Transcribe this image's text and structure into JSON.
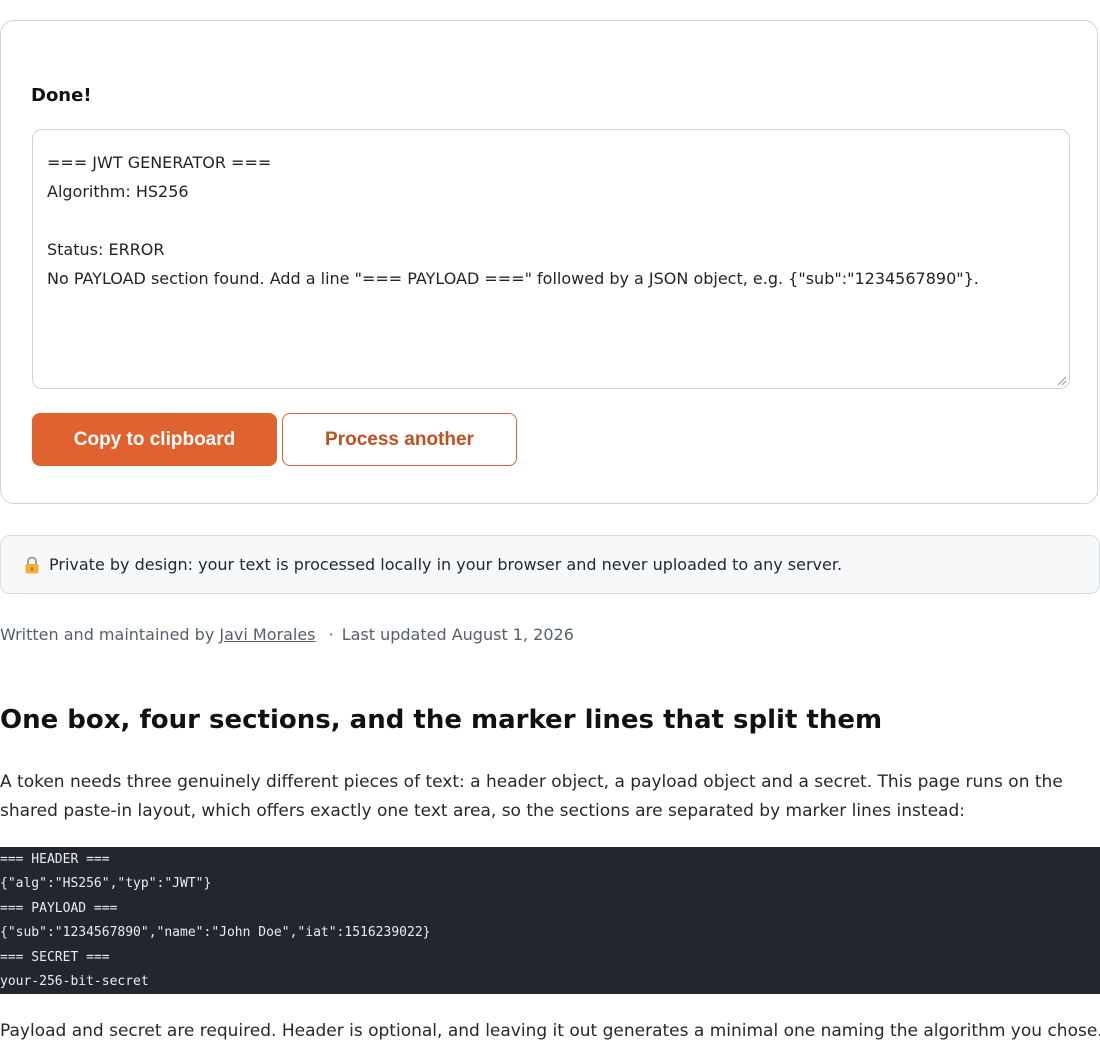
{
  "result": {
    "status_heading": "Done!",
    "output_lines": [
      "=== JWT GENERATOR ===",
      "Algorithm: HS256",
      "",
      "Status: ERROR",
      "No PAYLOAD section found. Add a line \"=== PAYLOAD ===\" followed by a JSON object, e.g. {\"sub\":\"1234567890\"}."
    ],
    "copy_button": "Copy to clipboard",
    "another_button": "Process another"
  },
  "privacy_note": "Private by design: your text is processed locally in your browser and never uploaded to any server.",
  "byline": {
    "prefix": "Written and maintained by",
    "author": "Javi Morales",
    "separator": "·",
    "updated": "Last updated August 1, 2026"
  },
  "article": {
    "heading": "One box, four sections, and the marker lines that split them",
    "para1": "A token needs three genuinely different pieces of text: a header object, a payload object and a secret. This page runs on the shared paste-in layout, which offers exactly one text area, so the sections are separated by marker lines instead:",
    "code_lines": [
      "=== HEADER ===",
      "{\"alg\":\"HS256\",\"typ\":\"JWT\"}",
      "=== PAYLOAD ===",
      "{\"sub\":\"1234567890\",\"name\":\"John Doe\",\"iat\":1516239022}",
      "=== SECRET ===",
      "your-256-bit-secret"
    ],
    "para2": "Payload and secret are required. Header is optional, and leaving it out generates a minimal one naming the algorithm you chose. A"
  },
  "colors": {
    "accent": "#e0622e",
    "code_bg": "#22272e"
  },
  "icons": {
    "lock": "lock-icon"
  }
}
